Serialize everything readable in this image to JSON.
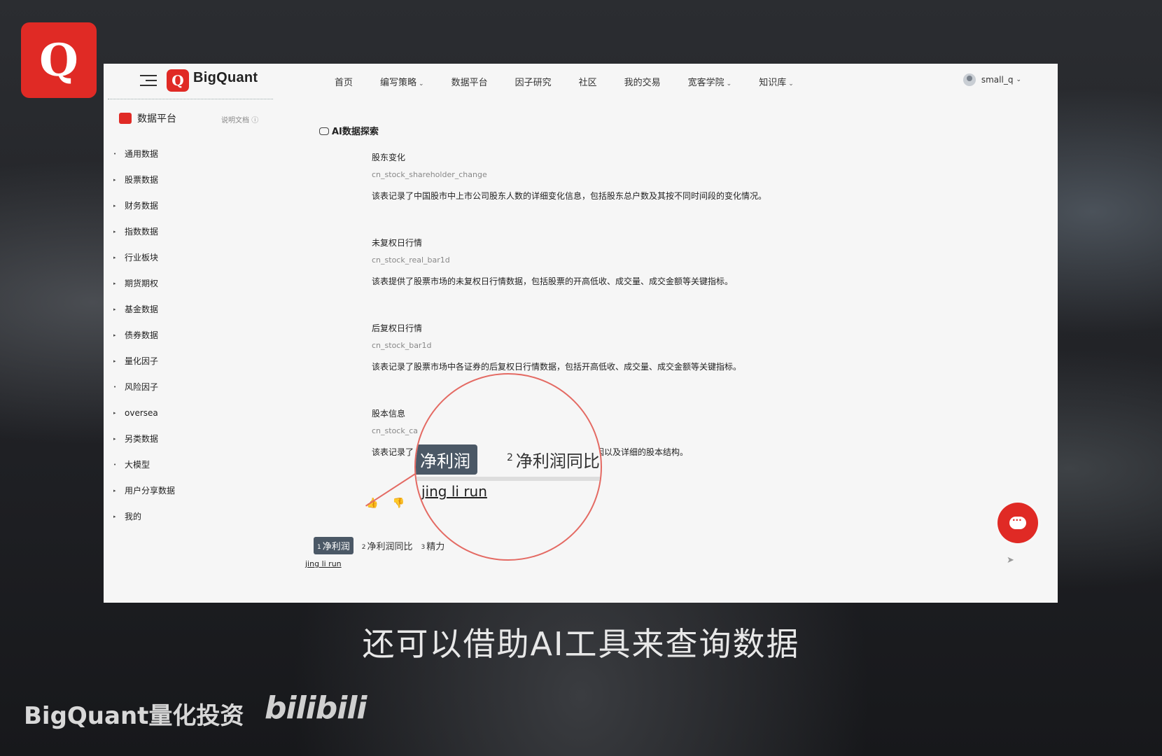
{
  "overlay": {
    "subtitle": "还可以借助AI工具来查询数据",
    "watermark_left": "BigQuant量化投资",
    "watermark_bili": "bilibili",
    "logo_letter": "Q"
  },
  "header": {
    "brand_letter": "Q",
    "brand_name": "BigQuant",
    "nav": [
      {
        "label": "首页",
        "dropdown": false
      },
      {
        "label": "编写策略",
        "dropdown": true
      },
      {
        "label": "数据平台",
        "dropdown": false
      },
      {
        "label": "因子研究",
        "dropdown": false
      },
      {
        "label": "社区",
        "dropdown": false
      },
      {
        "label": "我的交易",
        "dropdown": false
      },
      {
        "label": "宽客学院",
        "dropdown": true
      },
      {
        "label": "知识库",
        "dropdown": true
      }
    ],
    "user_name": "small_q"
  },
  "sidebar": {
    "title": "数据平台",
    "doc_link": "说明文档",
    "items": [
      {
        "label": "通用数据",
        "marker": "•"
      },
      {
        "label": "股票数据",
        "marker": "▸"
      },
      {
        "label": "财务数据",
        "marker": "▸"
      },
      {
        "label": "指数数据",
        "marker": "▸"
      },
      {
        "label": "行业板块",
        "marker": "▸"
      },
      {
        "label": "期货期权",
        "marker": "▸"
      },
      {
        "label": "基金数据",
        "marker": "▸"
      },
      {
        "label": "债券数据",
        "marker": "▸"
      },
      {
        "label": "量化因子",
        "marker": "▸"
      },
      {
        "label": "风险因子",
        "marker": "•"
      },
      {
        "label": "oversea",
        "marker": "▸"
      },
      {
        "label": "另类数据",
        "marker": "▸"
      },
      {
        "label": "大模型",
        "marker": "•"
      },
      {
        "label": "用户分享数据",
        "marker": "▸"
      },
      {
        "label": "我的",
        "marker": "▸"
      }
    ]
  },
  "main": {
    "title": "AI数据探索",
    "entries": [
      {
        "title": "股东变化",
        "code": "cn_stock_shareholder_change",
        "desc": "该表记录了中国股市中上市公司股东人数的详细变化信息，包括股东总户数及其按不同时间段的变化情况。"
      },
      {
        "title": "未复权日行情",
        "code": "cn_stock_real_bar1d",
        "desc": "该表提供了股票市场的未复权日行情数据，包括股票的开高低收、成交量、成交金额等关键指标。"
      },
      {
        "title": "后复权日行情",
        "code": "cn_stock_bar1d",
        "desc": "该表记录了股票市场中各证券的后复权日行情数据，包括开高低收、成交量、成交金额等关键指标。"
      },
      {
        "title": "股本信息",
        "code": "cn_stock_ca",
        "desc": "该表记录了",
        "desc_tail": "原因以及详细的股本结构。"
      }
    ],
    "feedback": {
      "like": "👍",
      "dislike": "👎"
    }
  },
  "ime": {
    "candidates": [
      {
        "num": "1",
        "text": "净利润"
      },
      {
        "num": "2",
        "text": "净利润同比"
      },
      {
        "num": "3",
        "text": "精力"
      }
    ],
    "pinyin": "jing li run",
    "zoom_candidates": [
      {
        "num": "",
        "text": "净利润"
      },
      {
        "num": "2",
        "text": "净利润同比"
      }
    ]
  },
  "colors": {
    "brand": "#e02a25",
    "ime_selected": "#4b5866",
    "magnifier": "#e46a63"
  }
}
